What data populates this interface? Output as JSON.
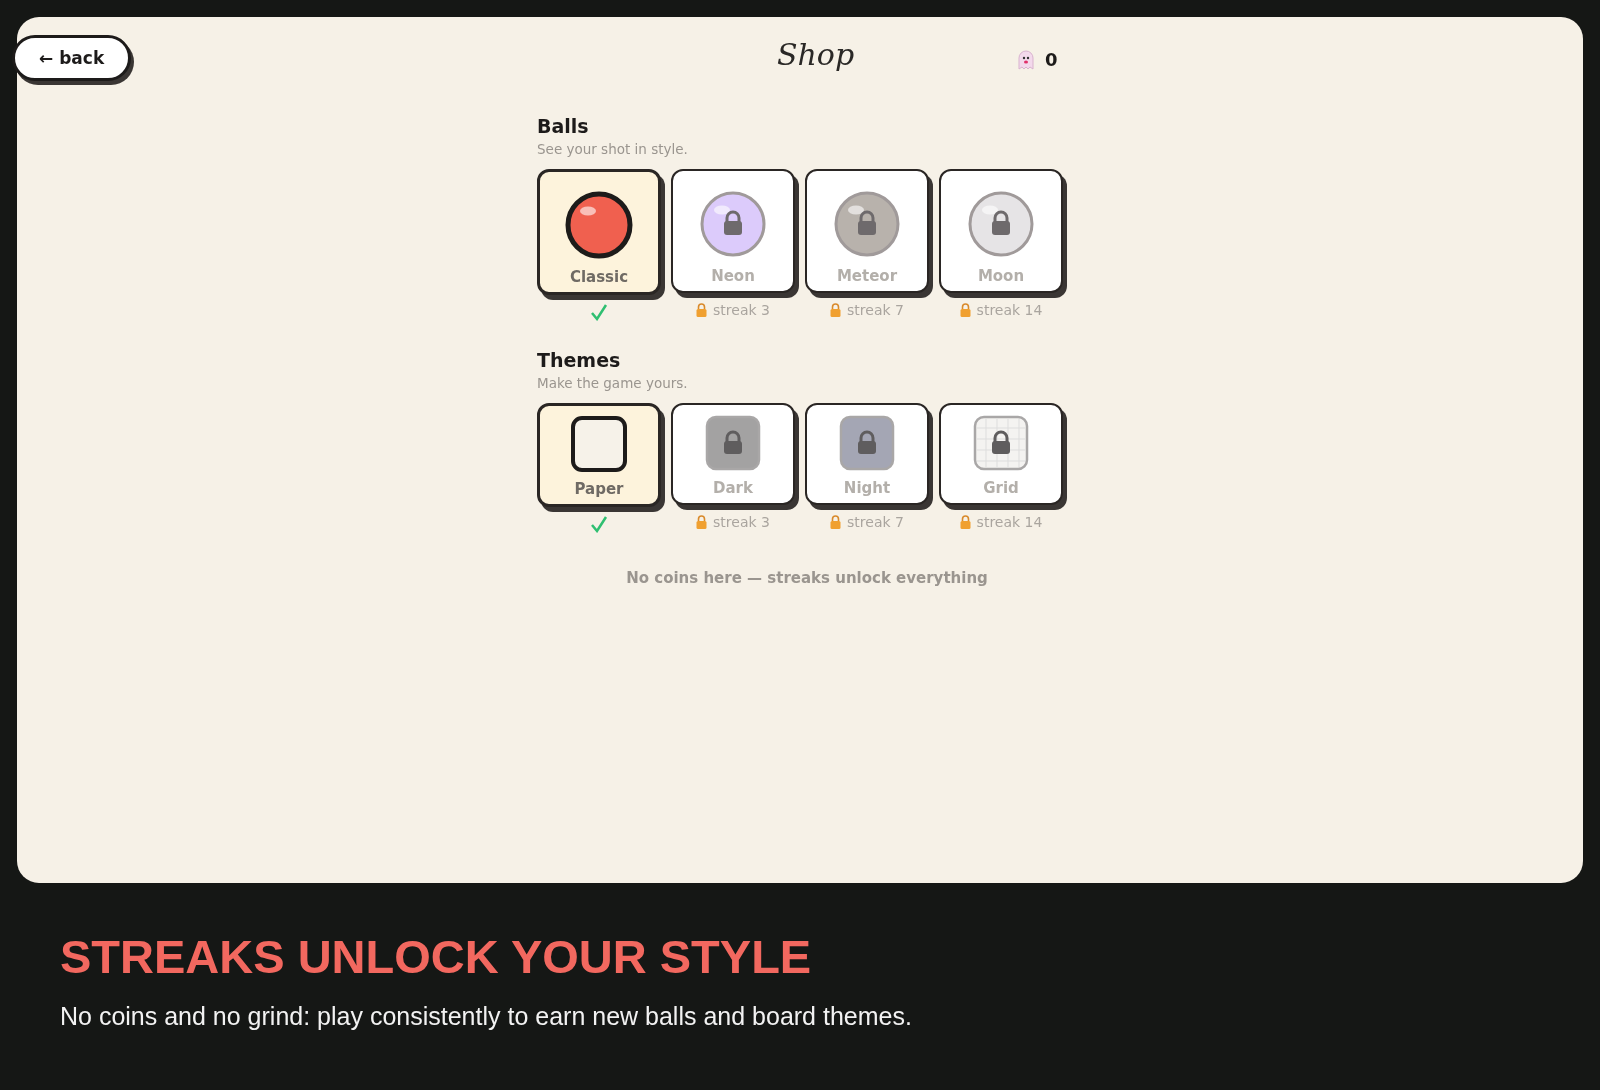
{
  "back_button": {
    "label": "← back"
  },
  "title": "Shop",
  "counter": {
    "value": "0"
  },
  "sections": [
    {
      "kind": "ball",
      "title": "Balls",
      "subtitle": "See your shot in style.",
      "items": [
        {
          "name": "Classic",
          "selected": true,
          "locked": false,
          "color": "#f0604f"
        },
        {
          "name": "Neon",
          "selected": false,
          "locked": true,
          "color": "#dccbfb",
          "requirement": "streak 3"
        },
        {
          "name": "Meteor",
          "selected": false,
          "locked": true,
          "color": "#b8b2ac",
          "requirement": "streak 7"
        },
        {
          "name": "Moon",
          "selected": false,
          "locked": true,
          "color": "#e6e4e6",
          "requirement": "streak 14"
        }
      ]
    },
    {
      "kind": "theme",
      "title": "Themes",
      "subtitle": "Make the game yours.",
      "items": [
        {
          "name": "Paper",
          "selected": true,
          "locked": false,
          "color": "#f6f2e9"
        },
        {
          "name": "Dark",
          "selected": false,
          "locked": true,
          "color": "#a3a2a2",
          "requirement": "streak 3"
        },
        {
          "name": "Night",
          "selected": false,
          "locked": true,
          "color": "#a4a6b4",
          "requirement": "streak 7"
        },
        {
          "name": "Grid",
          "selected": false,
          "locked": true,
          "color": "#f4f3f1",
          "requirement": "streak 14",
          "grid": true
        }
      ]
    }
  ],
  "footer_note": "No coins here — streaks unlock everything",
  "caption": {
    "heading": "STREAKS UNLOCK YOUR STYLE",
    "text": "No coins and no grind: play consistently to earn new balls and board themes."
  }
}
